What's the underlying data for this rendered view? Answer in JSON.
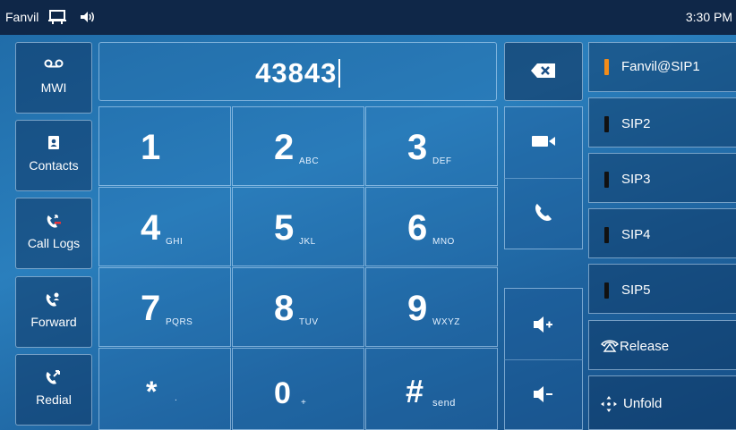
{
  "status_bar": {
    "brand": "Fanvil",
    "time": "3:30 PM",
    "icons": [
      "screen-icon",
      "volume-icon"
    ]
  },
  "sidebar": {
    "items": [
      {
        "label": "MWI",
        "icon": "voicemail-icon"
      },
      {
        "label": "Contacts",
        "icon": "contacts-icon"
      },
      {
        "label": "Call Logs",
        "icon": "call-logs-icon"
      },
      {
        "label": "Forward",
        "icon": "forward-icon"
      },
      {
        "label": "Redial",
        "icon": "redial-icon"
      }
    ]
  },
  "dialer": {
    "number": "43843"
  },
  "keypad": {
    "keys": [
      {
        "digit": "1",
        "letters": ""
      },
      {
        "digit": "2",
        "letters": "ABC"
      },
      {
        "digit": "3",
        "letters": "DEF"
      },
      {
        "digit": "4",
        "letters": "GHI"
      },
      {
        "digit": "5",
        "letters": "JKL"
      },
      {
        "digit": "6",
        "letters": "MNO"
      },
      {
        "digit": "7",
        "letters": "PQRS"
      },
      {
        "digit": "8",
        "letters": "TUV"
      },
      {
        "digit": "9",
        "letters": "WXYZ"
      },
      {
        "digit": "*",
        "letters": "."
      },
      {
        "digit": "0",
        "letters": "+"
      },
      {
        "digit": "#",
        "letters": "send"
      }
    ]
  },
  "actions": {
    "icons": [
      "backspace-icon",
      "video-call-icon",
      "audio-call-icon",
      "volume-up-icon",
      "volume-down-icon"
    ]
  },
  "lines": {
    "items": [
      {
        "label": "Fanvil@SIP1",
        "status_color": "#f28c1a"
      },
      {
        "label": "SIP2",
        "status_color": "#111111"
      },
      {
        "label": "SIP3",
        "status_color": "#111111"
      },
      {
        "label": "SIP4",
        "status_color": "#111111"
      },
      {
        "label": "SIP5",
        "status_color": "#111111"
      }
    ],
    "release_label": "Release",
    "unfold_label": "Unfold"
  }
}
